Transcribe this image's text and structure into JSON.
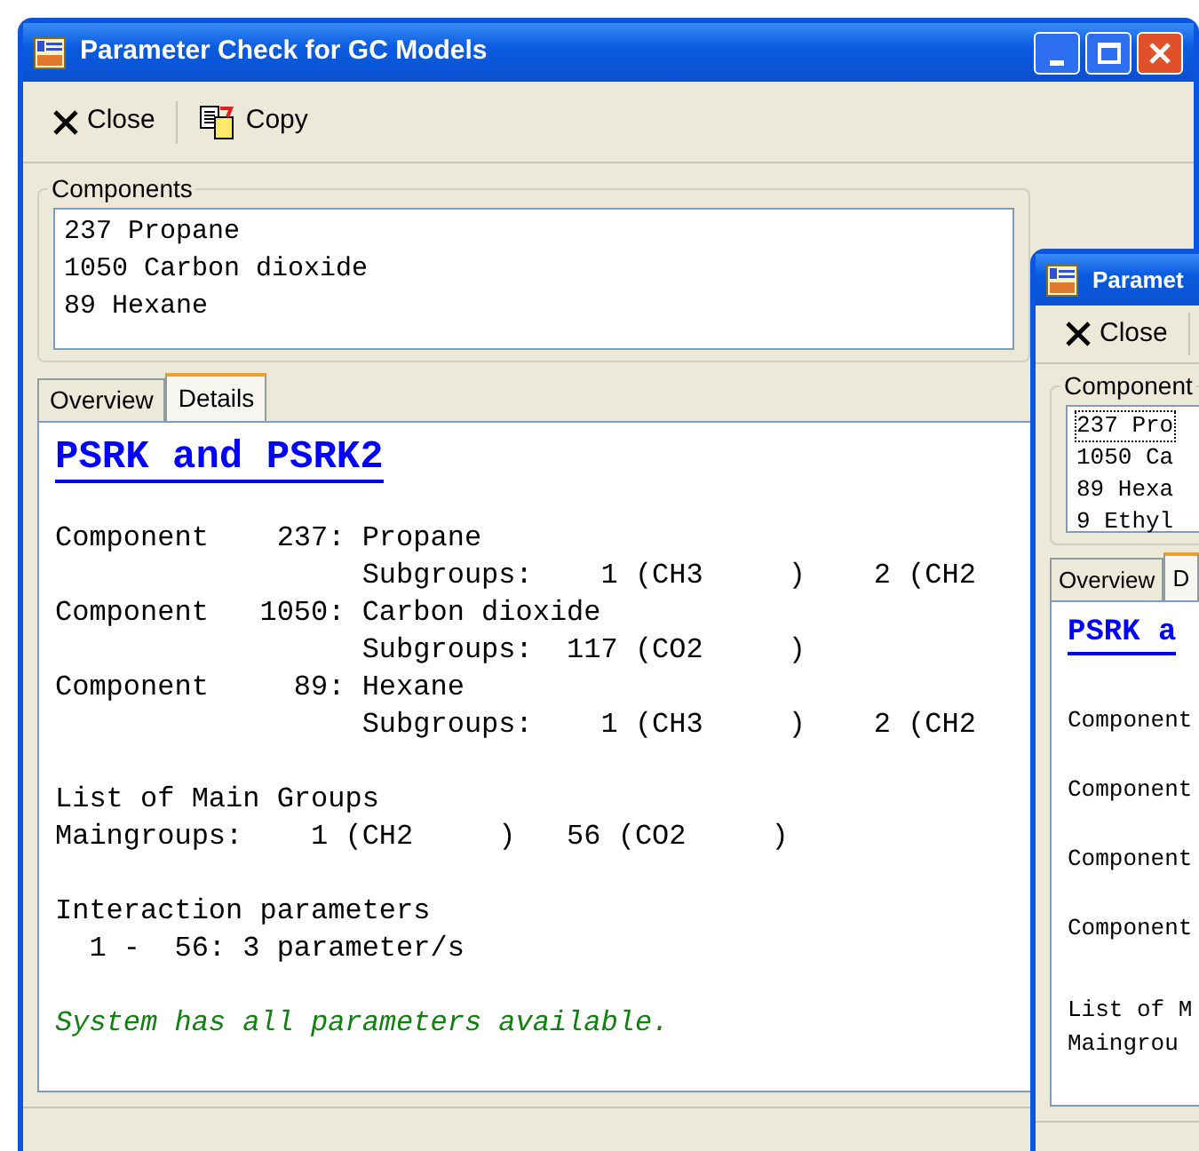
{
  "windows": [
    {
      "title": "Parameter Check for GC Models",
      "active": true,
      "toolbar": [
        {
          "kind": "close",
          "label": "Close"
        },
        {
          "kind": "copy",
          "label": "Copy"
        }
      ],
      "components_label": "Components",
      "components": [
        {
          "text": "237 Propane",
          "focused": false
        },
        {
          "text": "1050 Carbon dioxide",
          "focused": false
        },
        {
          "text": "89 Hexane",
          "focused": false
        }
      ],
      "tabs": [
        {
          "label": "Overview",
          "selected": false
        },
        {
          "label": "Details",
          "selected": true
        }
      ],
      "heading": "PSRK and PSRK2",
      "blocks": [
        [
          "Component    237: Propane",
          "                  Subgroups:    1 (CH3     )    2 (CH2",
          "Component   1050: Carbon dioxide",
          "                  Subgroups:  117 (CO2     )",
          "Component     89: Hexane",
          "                  Subgroups:    1 (CH3     )    2 (CH2"
        ],
        [
          "List of Main Groups",
          "Maingroups:    1 (CH2     )   56 (CO2     )"
        ],
        [
          "Interaction parameters",
          "  1 -  56: 3 parameter/s"
        ]
      ],
      "status": "System has all parameters available."
    },
    {
      "title": "Paramet",
      "active": true,
      "toolbar": [
        {
          "kind": "close",
          "label": "Close"
        }
      ],
      "components_label": "Component",
      "components": [
        {
          "text": "237 Pro",
          "focused": true
        },
        {
          "text": "1050 Ca",
          "focused": false
        },
        {
          "text": "89 Hexa",
          "focused": false
        },
        {
          "text": "9 Ethyl",
          "focused": false
        }
      ],
      "tabs": [
        {
          "label": "Overview",
          "selected": false
        },
        {
          "label": "D",
          "selected": true
        }
      ],
      "heading": "PSRK a",
      "blocks": [
        [
          "Component",
          "Component",
          "Component",
          "Component"
        ],
        [
          "List of M",
          "Maingrou"
        ]
      ]
    }
  ]
}
